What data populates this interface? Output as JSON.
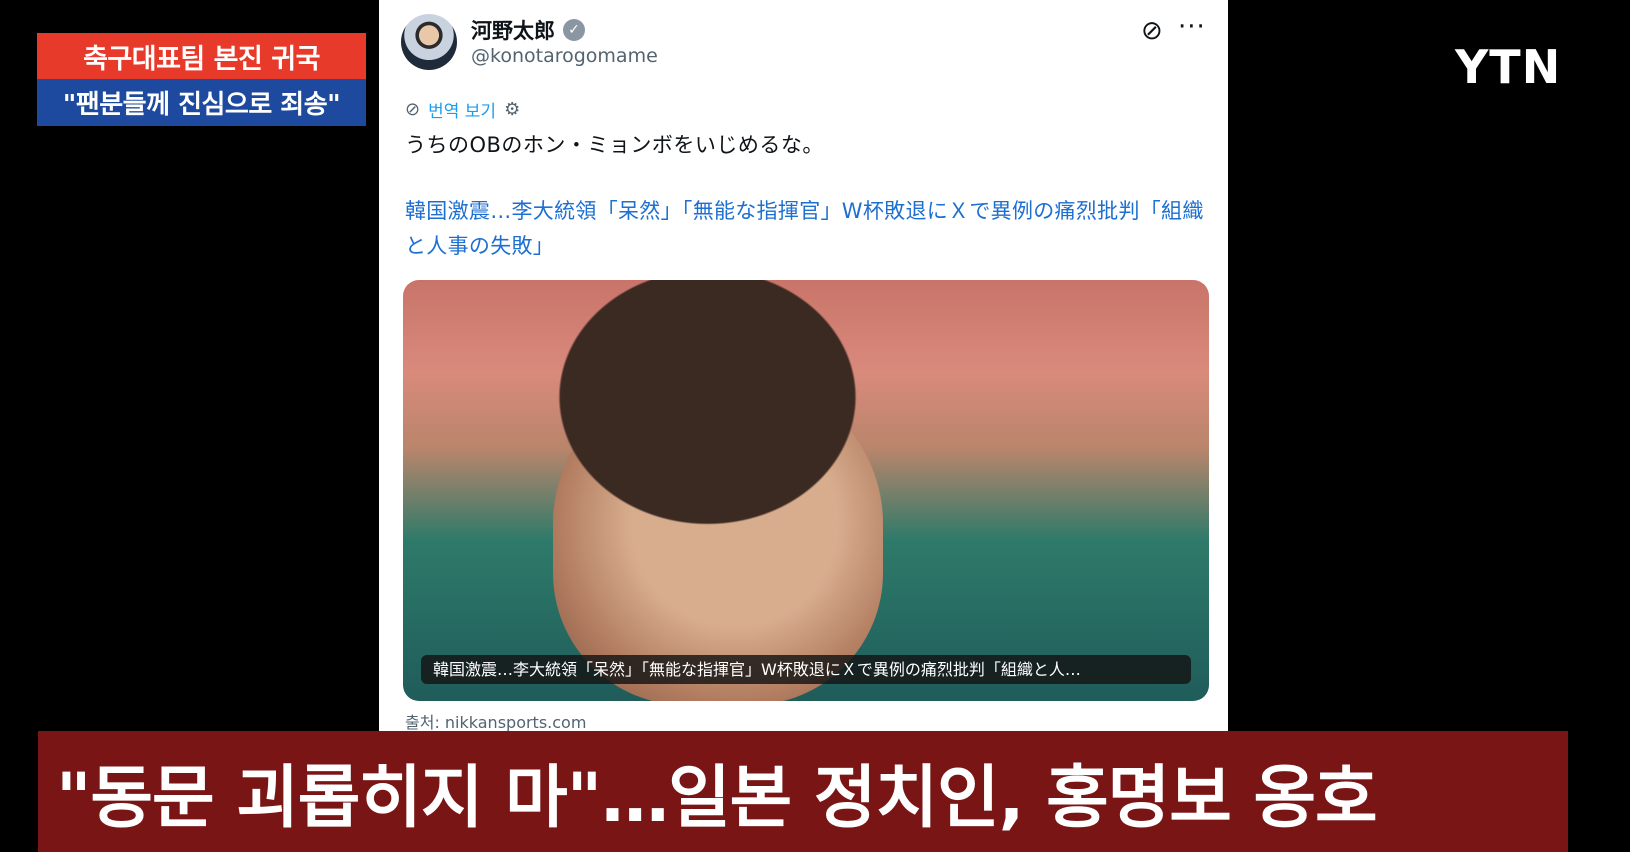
{
  "ticker": {
    "line1": "축구대표팀 본진 귀국",
    "line2": "\"팬분들께 진심으로 죄송\"",
    "colors": {
      "top": "#e83a2b",
      "bottom": "#1d4a9e"
    }
  },
  "logo": {
    "text": "YTN"
  },
  "tweet": {
    "author_name": "河野太郎",
    "verified_icon": "verified-badge-icon",
    "handle": "@konotarogomame",
    "translate_label": "번역 보기",
    "text": "うちのOBのホン・ミョンボをいじめるな。",
    "link_title": "韓国激震…李大統領「呆然」「無能な指揮官」W杯敗退にＸで異例の痛烈批判「組織と人事の失敗」",
    "media_caption": "韓国激震…李大統領「呆然」「無能な指揮官」W杯敗退にＸで異例の痛烈批判「組織と人…",
    "source": "출처: nikkansports.com",
    "accent_color": "#1d9bf0"
  },
  "headline": {
    "text": "\"동문 괴롭히지 마\"…일본 정치인, 홍명보 옹호",
    "color": "#7a1515"
  }
}
